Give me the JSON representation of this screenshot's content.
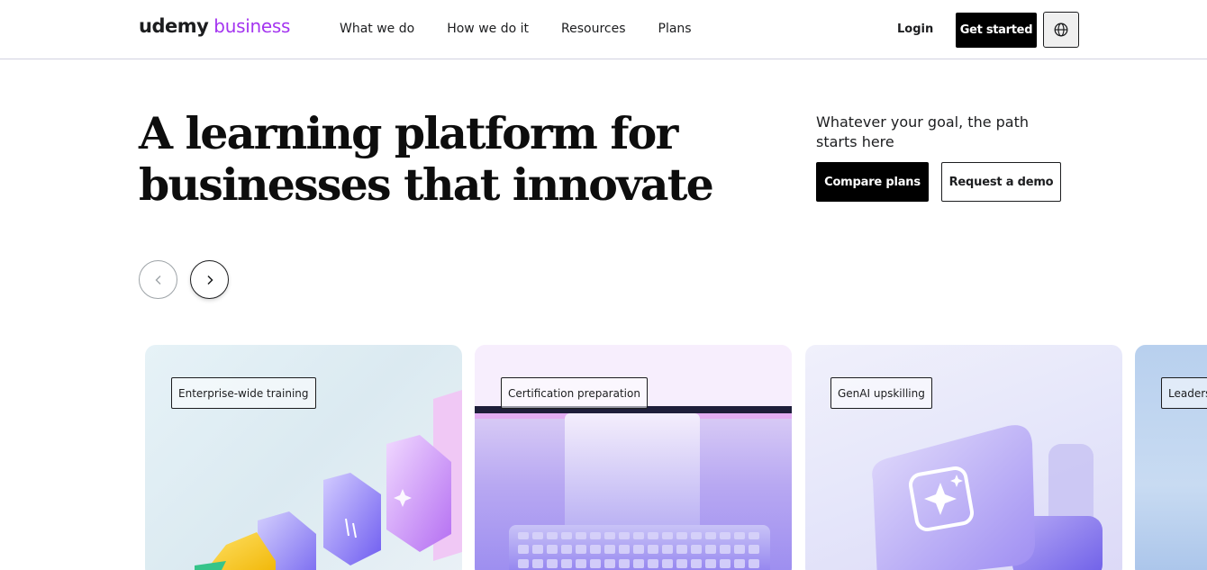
{
  "header": {
    "logo_primary": "udemy",
    "logo_secondary": "business",
    "nav": [
      "What we do",
      "How we do it",
      "Resources",
      "Plans"
    ],
    "login_label": "Login",
    "cta_label": "Get started",
    "language_icon": "globe-icon"
  },
  "hero": {
    "title_line1": "A learning platform for",
    "title_line2": "businesses that innovate",
    "subtitle": "Whatever your goal, the path starts here",
    "primary_button": "Compare plans",
    "secondary_button": "Request a demo",
    "prev_icon": "chevron-left-icon",
    "next_icon": "chevron-right-icon"
  },
  "cards": [
    {
      "tag": "Enterprise-wide training"
    },
    {
      "tag": "Certification preparation"
    },
    {
      "tag": "GenAI upskilling"
    },
    {
      "tag": "Leaders"
    }
  ],
  "colors": {
    "brand_purple": "#a435f0",
    "text_dark": "#1c1d1f",
    "button_black": "#000000"
  }
}
